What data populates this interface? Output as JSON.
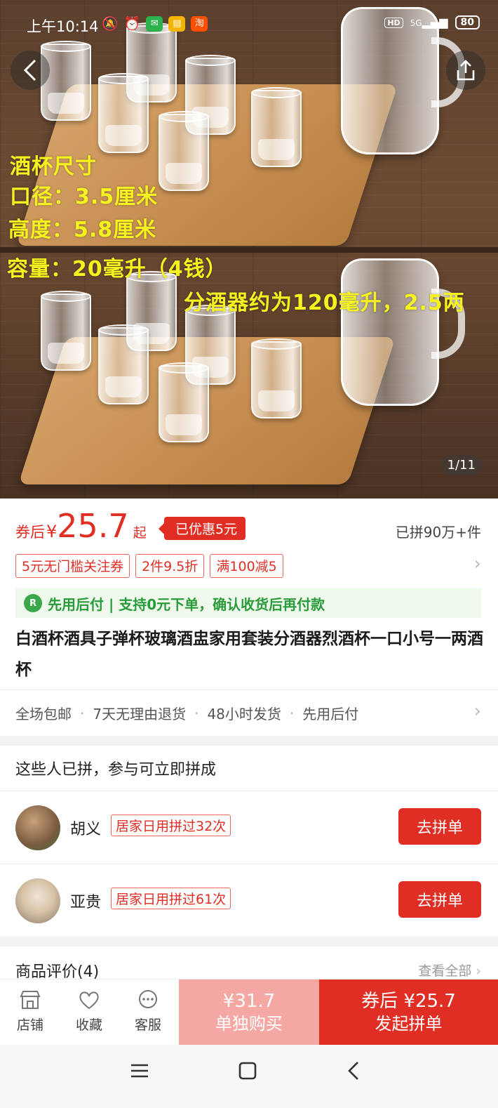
{
  "status_bar": {
    "time": "上午10:14",
    "network": "5G",
    "hd": "HD",
    "battery": "80"
  },
  "gallery": {
    "overlay_lines": [
      "酒杯尺寸",
      "口径：3.5厘米",
      "高度：5.8厘米",
      "容量：20毫升（4钱）",
      "分酒器约为120毫升，2.5两"
    ],
    "counter": "1/11"
  },
  "price": {
    "label": "券后",
    "yen": "¥",
    "value": "25.7",
    "suffix": "起",
    "discount_tag": "已优惠5元",
    "sold": "已拼90万+件"
  },
  "coupons": [
    "5元无门槛关注券",
    "2件9.5折",
    "满100减5"
  ],
  "paylater": {
    "icon_text": "R",
    "text": "先用后付 | 支持0元下单，确认收货后再付款"
  },
  "product_title": "白酒杯酒具子弹杯玻璃酒盅家用套装分酒器烈酒杯一口小号一两酒杯",
  "services": [
    "全场包邮",
    "7天无理由退货",
    "48小时发货",
    "先用后付"
  ],
  "group_buy": {
    "heading": "这些人已拼，参与可立即拼成",
    "rows": [
      {
        "name": "胡义",
        "tag": "居家日用拼过32次",
        "button": "去拼单"
      },
      {
        "name": "亚贵",
        "tag": "居家日用拼过61次",
        "button": "去拼单"
      }
    ]
  },
  "reviews": {
    "heading": "商品评价(4)",
    "see_all": "查看全部"
  },
  "bottom_bar": {
    "shop": "店铺",
    "favorite": "收藏",
    "service": "客服",
    "buy_alone_price": "¥31.7",
    "buy_alone_label": "单独购买",
    "buy_group_price": "券后 ¥25.7",
    "buy_group_label": "发起拼单"
  },
  "colors": {
    "accent": "#e02e24",
    "overlay_text": "#f5f21e",
    "paylater_green": "#2a9b3a"
  }
}
